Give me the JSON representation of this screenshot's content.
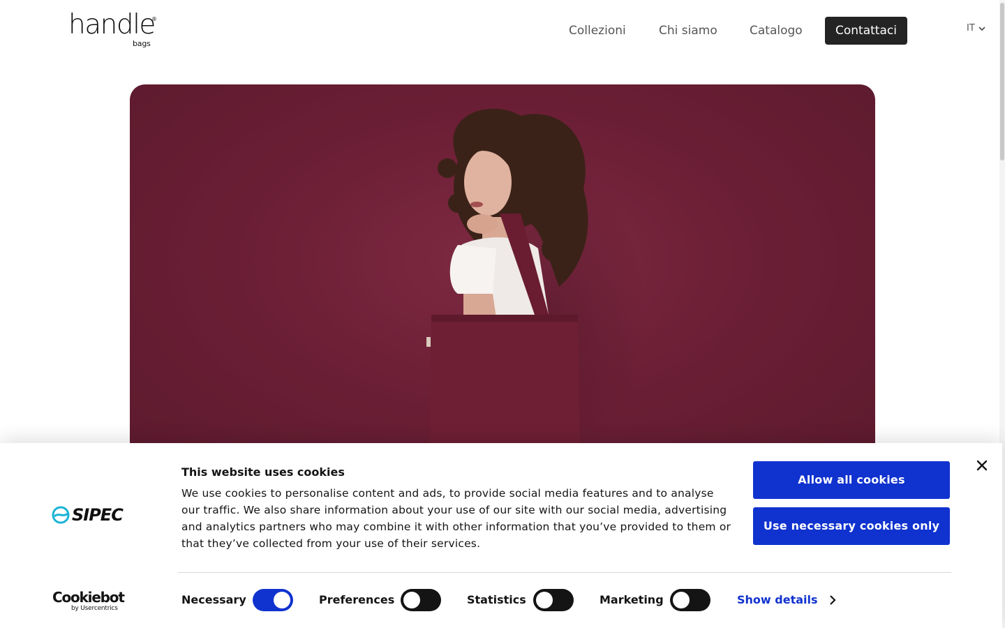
{
  "header": {
    "logo_text": "handle",
    "logo_registered": "®",
    "logo_sub": "bags",
    "nav": [
      {
        "label": "Collezioni"
      },
      {
        "label": "Chi siamo"
      },
      {
        "label": "Catalogo"
      }
    ],
    "cta_label": "Contattaci",
    "language": "IT",
    "language_icon": "chevron-down-icon"
  },
  "hero": {
    "image": "woman-with-burgundy-tote-bag",
    "background_color": "#6c1f36"
  },
  "cookie_banner": {
    "brand_logo_text": "SIPEC",
    "title": "This website uses cookies",
    "text": "We use cookies to personalise content and ads, to provide social media features and to analyse our traffic. We also share information about your use of our site with our social media, advertising and analytics partners who may combine it with other information that you’ve provided to them or that they’ve collected from your use of their services.",
    "allow_all_label": "Allow all cookies",
    "necessary_only_label": "Use necessary cookies only",
    "close_icon": "close-icon",
    "cookiebot_text": "Cookiebot",
    "cookiebot_sub": "by Usercentrics",
    "toggles": [
      {
        "label": "Necessary",
        "checked": true
      },
      {
        "label": "Preferences",
        "checked": false
      },
      {
        "label": "Statistics",
        "checked": false
      },
      {
        "label": "Marketing",
        "checked": false
      }
    ],
    "show_details_label": "Show details",
    "accent_color": "#1032cf"
  }
}
